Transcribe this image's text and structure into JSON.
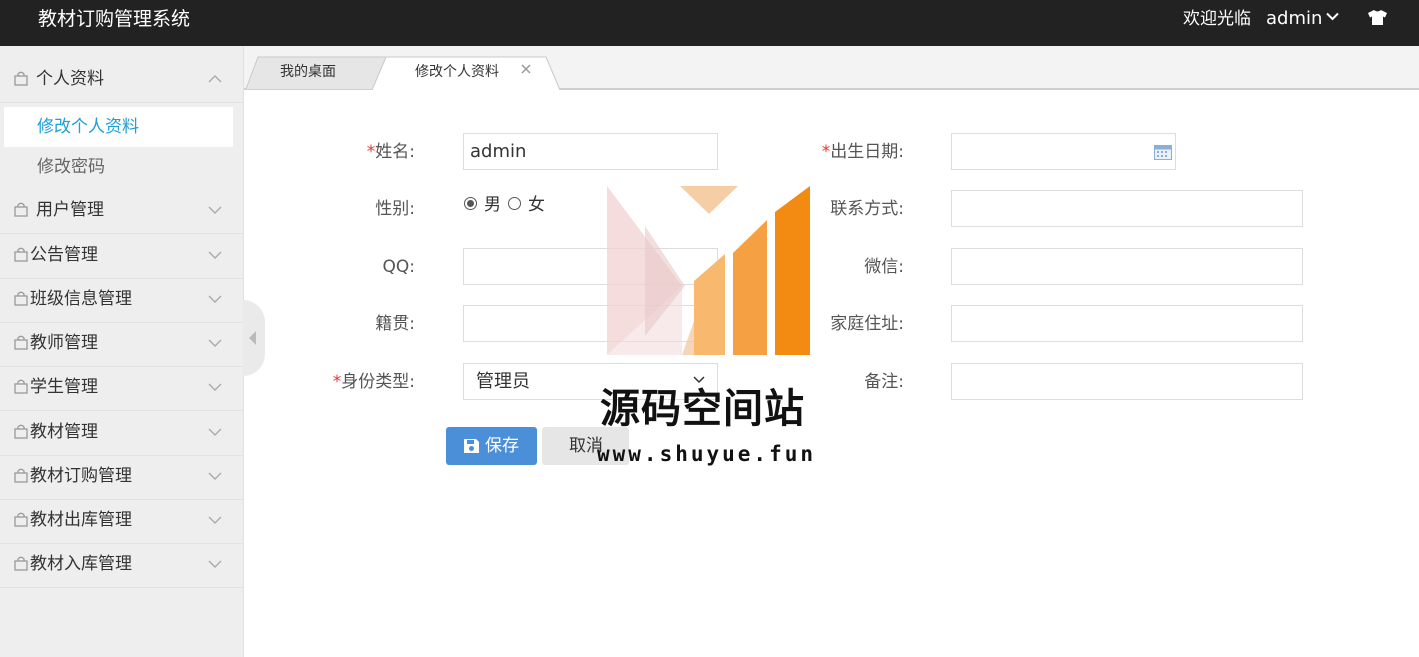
{
  "header": {
    "app_title": "教材订购管理系统",
    "welcome_text": "欢迎光临",
    "username": "admin",
    "theme_icon": "tshirt-icon"
  },
  "sidebar": {
    "groups": [
      {
        "label": "个人资料",
        "expanded": true,
        "children": [
          {
            "label": "修改个人资料",
            "active": true
          },
          {
            "label": "修改密码",
            "active": false
          }
        ]
      },
      {
        "label": "用户管理",
        "expanded": false
      },
      {
        "label": "公告管理",
        "expanded": false
      },
      {
        "label": "班级信息管理",
        "expanded": false
      },
      {
        "label": "教师管理",
        "expanded": false
      },
      {
        "label": "学生管理",
        "expanded": false
      },
      {
        "label": "教材管理",
        "expanded": false
      },
      {
        "label": "教材订购管理",
        "expanded": false
      },
      {
        "label": "教材出库管理",
        "expanded": false
      },
      {
        "label": "教材入库管理",
        "expanded": false
      }
    ]
  },
  "tabs": [
    {
      "label": "我的桌面",
      "active": false,
      "closable": false
    },
    {
      "label": "修改个人资料",
      "active": true,
      "closable": true
    }
  ],
  "form": {
    "required_mark": "*",
    "name": {
      "label": "姓名:",
      "value": "admin",
      "required": true
    },
    "birthdate": {
      "label": "出生日期:",
      "value": "",
      "required": true
    },
    "gender": {
      "label": "性别:",
      "options": [
        "男",
        "女"
      ],
      "selected": "男"
    },
    "contact": {
      "label": "联系方式:",
      "value": ""
    },
    "qq": {
      "label": "QQ:",
      "value": ""
    },
    "wechat": {
      "label": "微信:",
      "value": ""
    },
    "hometown": {
      "label": "籍贯:",
      "value": ""
    },
    "address": {
      "label": "家庭住址:",
      "value": ""
    },
    "identity": {
      "label": "身份类型:",
      "value": "管理员",
      "required": true
    },
    "remark": {
      "label": "备注:",
      "value": ""
    },
    "save_label": "保存",
    "cancel_label": "取消"
  },
  "watermark": {
    "title": "源码空间站",
    "url": "www.shuyue.fun"
  },
  "colors": {
    "topbar": "#222222",
    "sidebar_bg": "#eeeeee",
    "active_link": "#1e9fd6",
    "save_button": "#4b8fd8",
    "required": "#ee3333"
  }
}
